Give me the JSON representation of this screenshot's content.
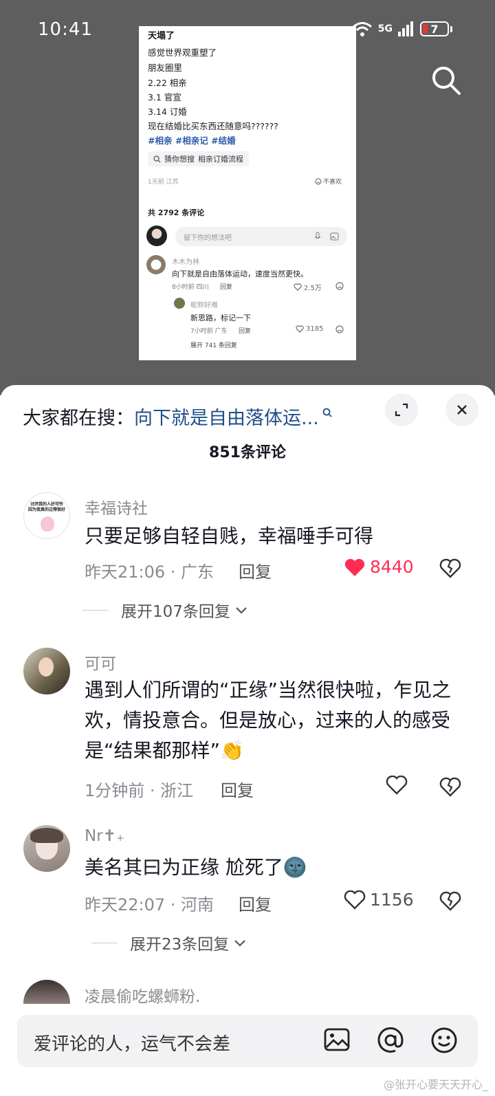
{
  "status_bar": {
    "time": "10:41",
    "network": "5G",
    "battery": "7"
  },
  "post": {
    "lines": [
      "天塌了",
      "感觉世界观重塑了",
      "朋友圈里",
      "2.22 相亲",
      "3.1 官宣",
      "3.14 订婚",
      "现在结婚比买东西还随意吗??????"
    ],
    "tags": "#相亲 #相亲记 #结婚",
    "guess_label": "猜你想搜",
    "guess_term": "相亲订婚流程",
    "time_location": "1天前 江苏",
    "dislike_label": "不喜欢",
    "comment_count": "共 2792 条评论",
    "input_placeholder": "留下你的想法吧",
    "comments": [
      {
        "user": "木木为林",
        "text": "向下就是自由落体运动，速度当然更快。",
        "meta": "8小时前 四川",
        "reply": "回复",
        "likes": "2.5万"
      },
      {
        "user": "昵称好难",
        "text": "新思路，标记一下",
        "meta": "7小时前 广东",
        "reply": "回复",
        "likes": "3185"
      }
    ],
    "expand": "展开 741 条回复"
  },
  "sheet": {
    "search_label": "大家都在搜：",
    "search_query": "向下就是自由落体运...",
    "title": "851条评论"
  },
  "comments": [
    {
      "user": "幸福诗社",
      "text": "只要足够自轻自贱，幸福唾手可得",
      "meta": "昨天21:06 · 广东",
      "reply": "回复",
      "likes": "8440",
      "liked": true,
      "expand": "展开107条回复",
      "avatar_text": [
        "讨厌我的人好可怜",
        "因为我真的过得很好"
      ]
    },
    {
      "user": "可可",
      "text": "遇到人们所谓的“正缘”当然很快啦，乍见之欢，情投意合。但是放心，过来的人的感受是“结果都那样”👏",
      "meta": "1分钟前 · 浙江",
      "reply": "回复",
      "likes": "",
      "liked": false
    },
    {
      "user": "Nr✝︎₊",
      "text": "美名其曰为正缘 尬死了🌚",
      "meta": "昨天22:07 · 河南",
      "reply": "回复",
      "likes": "1156",
      "liked": false,
      "expand": "展开23条回复"
    },
    {
      "user": "凌晨偷吃螺蛳粉.",
      "text": "",
      "meta": "",
      "reply": "",
      "likes": ""
    }
  ],
  "bottom": {
    "placeholder": "爱评论的人，运气不会差"
  },
  "watermark": "@张开心要天天开心_",
  "colors": {
    "like_red": "#fe2c55",
    "link_blue": "#1d4f86",
    "tag_blue": "#2a5caa"
  }
}
